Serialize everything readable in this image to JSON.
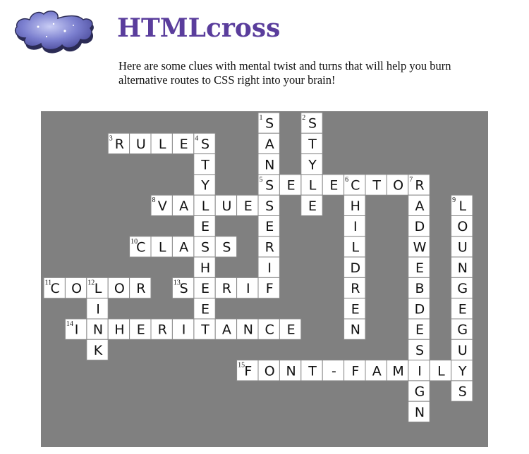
{
  "header": {
    "title": "HTMLcross",
    "intro": "Here are some clues with mental twist and turns that will help you burn alternative routes to CSS right into your brain!",
    "logo_icon": "puzzle-piece-icon"
  },
  "colors": {
    "title": "#5a3d9c",
    "board": "#808080",
    "cell": "#ffffff",
    "puzzle_piece": "#7b7fcf"
  },
  "grid": {
    "cols": 21,
    "rows": 16,
    "words": [
      {
        "number": "1",
        "answer": "SANSSERIF",
        "row": 0,
        "col": 10,
        "dir": "down"
      },
      {
        "number": "2",
        "answer": "STYLE",
        "row": 0,
        "col": 12,
        "dir": "down"
      },
      {
        "number": "3",
        "answer": "RULES",
        "row": 1,
        "col": 3,
        "dir": "across"
      },
      {
        "number": "4",
        "answer": "STYLESHEET",
        "row": 1,
        "col": 7,
        "dir": "down"
      },
      {
        "number": "5",
        "answer": "SELECTOR",
        "row": 3,
        "col": 10,
        "dir": "across"
      },
      {
        "number": "6",
        "answer": "CHILDREN",
        "row": 3,
        "col": 14,
        "dir": "down"
      },
      {
        "number": "7",
        "answer": "RADWEBDESIGN",
        "row": 3,
        "col": 17,
        "dir": "down"
      },
      {
        "number": "8",
        "answer": "VALUES",
        "row": 4,
        "col": 5,
        "dir": "across"
      },
      {
        "number": "9",
        "answer": "LOUNGEGUYS",
        "row": 4,
        "col": 19,
        "dir": "down"
      },
      {
        "number": "10",
        "answer": "CLASS",
        "row": 6,
        "col": 4,
        "dir": "across"
      },
      {
        "number": "11",
        "answer": "COLOR",
        "row": 8,
        "col": 0,
        "dir": "across"
      },
      {
        "number": "12",
        "answer": "LINK",
        "row": 8,
        "col": 2,
        "dir": "down"
      },
      {
        "number": "13",
        "answer": "SERIF",
        "row": 8,
        "col": 6,
        "dir": "across"
      },
      {
        "number": "14",
        "answer": "INHERITANCE",
        "row": 10,
        "col": 1,
        "dir": "across"
      },
      {
        "number": "15",
        "answer": "FONT-FAMILY",
        "row": 12,
        "col": 9,
        "dir": "across"
      }
    ]
  }
}
